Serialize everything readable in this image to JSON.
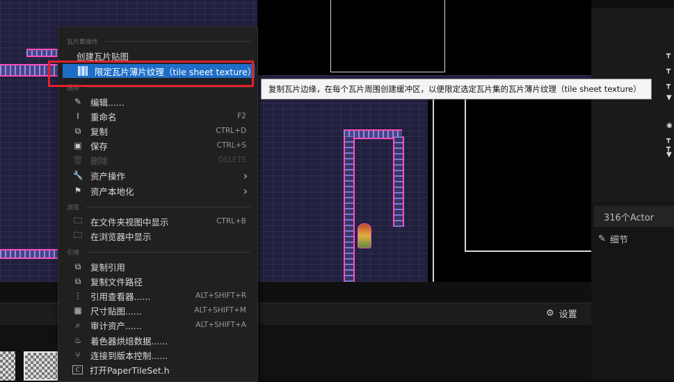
{
  "context_menu": {
    "sections": {
      "tileset": "瓦片集操作",
      "common": "通用",
      "explore": "浏览",
      "references": "引用"
    },
    "items": {
      "create_tilemap": "创建瓦片贴图",
      "condition_texture": "限定瓦片薄片纹理（tile sheet texture）",
      "edit": "编辑......",
      "rename": {
        "label": "重命名",
        "shortcut": "F2"
      },
      "duplicate": {
        "label": "复制",
        "shortcut": "CTRL+D"
      },
      "save": {
        "label": "保存",
        "shortcut": "CTRL+S"
      },
      "delete": {
        "label": "删除",
        "shortcut": "DELETE"
      },
      "asset_actions": "资产操作",
      "asset_localization": "资产本地化",
      "show_in_folder": {
        "label": "在文件夹视图中显示",
        "shortcut": "CTRL+B"
      },
      "show_in_browser": "在浏览器中显示",
      "copy_reference": "复制引用",
      "copy_file_path": "复制文件路径",
      "reference_viewer": {
        "label": "引用查看器......",
        "shortcut": "ALT+SHIFT+R"
      },
      "size_map": {
        "label": "尺寸贴图......",
        "shortcut": "ALT+SHIFT+M"
      },
      "audit_assets": {
        "label": "审计资产......",
        "shortcut": "ALT+SHIFT+A"
      },
      "shader_cook_data": "着色器烘焙数据......",
      "source_control": "连接到版本控制......",
      "open_header": "打开PaperTileSet.h"
    }
  },
  "tooltip": "复制瓦片边缘，在每个瓦片周围创建缓冲区，以便限定选定瓦片集的瓦片薄片纹理（tile sheet texture）",
  "outliner": {
    "actor_count": "316个Actor"
  },
  "details": {
    "tab_label": "细节"
  },
  "content_browser": {
    "settings_label": "设置"
  },
  "colors": {
    "highlight": "#1e6ec8",
    "annotation_box": "#e5202a",
    "menu_bg": "#202020"
  }
}
